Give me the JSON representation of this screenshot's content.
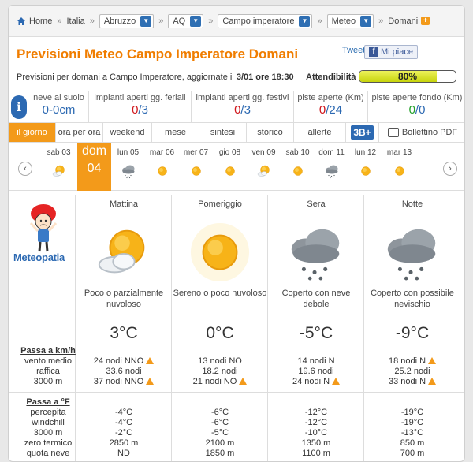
{
  "breadcrumb": {
    "home": "Home",
    "italia": "Italia",
    "region": "Abruzzo",
    "province": "AQ",
    "city": "Campo imperatore",
    "section": "Meteo",
    "page": "Domani"
  },
  "header": {
    "title": "Previsioni Meteo Campo Imperatore Domani",
    "tweet": "Tweet",
    "like": "Mi piace",
    "subtitle_prefix": "Previsioni per domani a Campo Imperatore, aggiornate il",
    "subtitle_time": "3/01 ore 18:30",
    "reliability_label": "Attendibilità",
    "reliability_value": "80%",
    "reliability_fraction": 0.8
  },
  "info": [
    {
      "label": "neve al suolo",
      "value": "0-0cm"
    },
    {
      "label": "impianti aperti gg. feriali",
      "open": "0",
      "total": "/3"
    },
    {
      "label": "impianti aperti gg. festivi",
      "open": "0",
      "total": "/3"
    },
    {
      "label": "piste aperte (Km)",
      "open": "0",
      "total": "/24"
    },
    {
      "label": "piste aperte fondo (Km)",
      "open": "0",
      "total": "/0"
    }
  ],
  "tabs": [
    "il giorno",
    "ora per ora",
    "weekend",
    "mese",
    "sintesi",
    "storico",
    "allerte",
    "3B+",
    "Bollettino PDF"
  ],
  "days": [
    {
      "name": "sab",
      "num": "03",
      "icon": "sun-cloud-icon"
    },
    {
      "name": "dom",
      "num": "04",
      "icon": "none"
    },
    {
      "name": "lun",
      "num": "05",
      "icon": "snow-cloud-icon"
    },
    {
      "name": "mar",
      "num": "06",
      "icon": "sun-icon"
    },
    {
      "name": "mer",
      "num": "07",
      "icon": "sun-icon"
    },
    {
      "name": "gio",
      "num": "08",
      "icon": "sun-icon"
    },
    {
      "name": "ven",
      "num": "09",
      "icon": "sun-cloud-icon"
    },
    {
      "name": "sab",
      "num": "10",
      "icon": "sun-icon"
    },
    {
      "name": "dom",
      "num": "11",
      "icon": "snow-cloud-icon"
    },
    {
      "name": "lun",
      "num": "12",
      "icon": "sun-icon"
    },
    {
      "name": "mar",
      "num": "13",
      "icon": "sun-icon"
    }
  ],
  "logo_text": "Meteopatia",
  "periods": [
    {
      "name": "Mattina",
      "icon": "sun-cloud-icon",
      "desc": "Poco o parzialmente nuvoloso",
      "temp": "3°C",
      "wind": "24 nodi NNO",
      "wind_warn": true,
      "gust": "33.6 nodi",
      "wind3000": "37 nodi NNO",
      "w3000_warn": true,
      "percepita": "-4°C",
      "windchill": "-4°C",
      "t3000": "-2°C",
      "zero": "2850 m",
      "snow": "ND"
    },
    {
      "name": "Pomeriggio",
      "icon": "sun-icon",
      "desc": "Sereno o poco nuvoloso",
      "temp": "0°C",
      "wind": "13 nodi NO",
      "wind_warn": false,
      "gust": "18.2 nodi",
      "wind3000": "21 nodi NO",
      "w3000_warn": true,
      "percepita": "-6°C",
      "windchill": "-6°C",
      "t3000": "-5°C",
      "zero": "2100 m",
      "snow": "1850 m"
    },
    {
      "name": "Sera",
      "icon": "snow-cloud-icon",
      "desc": "Coperto con neve debole",
      "temp": "-5°C",
      "wind": "14 nodi N",
      "wind_warn": false,
      "gust": "19.6 nodi",
      "wind3000": "24 nodi N",
      "w3000_warn": true,
      "percepita": "-12°C",
      "windchill": "-12°C",
      "t3000": "-10°C",
      "zero": "1350 m",
      "snow": "1100 m"
    },
    {
      "name": "Notte",
      "icon": "snow-cloud-icon",
      "desc": "Coperto con possibile nevischio",
      "temp": "-9°C",
      "wind": "18 nodi N",
      "wind_warn": true,
      "gust": "25.2 nodi",
      "wind3000": "33 nodi N",
      "w3000_warn": true,
      "percepita": "-19°C",
      "windchill": "-19°C",
      "t3000": "-13°C",
      "zero": "850 m",
      "snow": "700 m"
    }
  ],
  "rows": {
    "wind_header": "Passa a km/h",
    "wind": "vento medio",
    "gust": "raffica",
    "wind3000": "3000 m",
    "temp_header": "Passa a °F",
    "percepita": "percepita",
    "windchill": "windchill",
    "t3000": "3000 m",
    "zero": "zero termico",
    "snow": "quota neve"
  },
  "colors": {
    "accent": "#f39a1a",
    "title": "#f07d00",
    "blue": "#2c69b2",
    "red": "#d0161b",
    "green": "#22a028"
  }
}
